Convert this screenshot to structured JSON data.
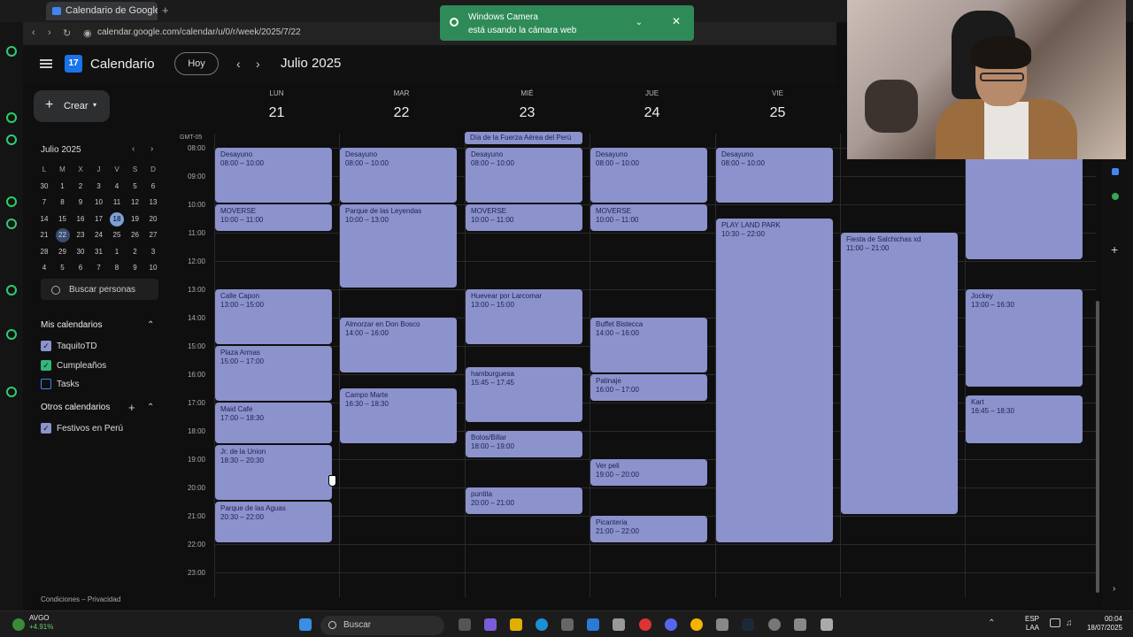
{
  "browser": {
    "tab_title": "Calendario de Google - S",
    "url": "calendar.google.com/calendar/u/0/r/week/2025/7/22"
  },
  "notification": {
    "title": "Windows Camera",
    "body": "está usando la cámara web"
  },
  "header": {
    "app_name": "Calendario",
    "logo_text": "17",
    "today_label": "Hoy",
    "month_label": "Julio 2025"
  },
  "sidebar": {
    "create_label": "Crear",
    "mini_calendar": {
      "title": "Julio 2025",
      "weekday_headers": [
        "L",
        "M",
        "X",
        "J",
        "V",
        "S",
        "D"
      ],
      "weeks": [
        [
          "30",
          "1",
          "2",
          "3",
          "4",
          "5",
          "6"
        ],
        [
          "7",
          "8",
          "9",
          "10",
          "11",
          "12",
          "13"
        ],
        [
          "14",
          "15",
          "16",
          "17",
          "18",
          "19",
          "20"
        ],
        [
          "21",
          "22",
          "23",
          "24",
          "25",
          "26",
          "27"
        ],
        [
          "28",
          "29",
          "30",
          "31",
          "1",
          "2",
          "3"
        ],
        [
          "4",
          "5",
          "6",
          "7",
          "8",
          "9",
          "10"
        ]
      ]
    },
    "search_people": "Buscar personas",
    "my_calendars_title": "Mis calendarios",
    "my_calendars": [
      {
        "label": "TaquitoTD",
        "checked": true,
        "color": "#8c92cc"
      },
      {
        "label": "Cumpleaños",
        "checked": true,
        "color": "#33b679"
      },
      {
        "label": "Tasks",
        "checked": false,
        "color": "#4285f4"
      }
    ],
    "other_calendars_title": "Otros calendarios",
    "other_calendars": [
      {
        "label": "Festivos en Perú",
        "checked": true,
        "color": "#8c92cc"
      }
    ],
    "footer": "Condiciones – Privacidad"
  },
  "week": {
    "timezone": "GMT-05",
    "days": [
      {
        "dow": "LUN",
        "num": "21"
      },
      {
        "dow": "MAR",
        "num": "22"
      },
      {
        "dow": "MIÉ",
        "num": "23"
      },
      {
        "dow": "JUE",
        "num": "24"
      },
      {
        "dow": "VIE",
        "num": "25"
      }
    ],
    "hours": [
      "08:00",
      "09:00",
      "10:00",
      "11:00",
      "12:00",
      "13:00",
      "14:00",
      "15:00",
      "16:00",
      "17:00",
      "18:00",
      "19:00",
      "20:00",
      "21:00",
      "22:00",
      "23:00"
    ],
    "all_day": {
      "title": "Día de la Fuerza Aérea del Perú",
      "day": 2
    },
    "events": [
      {
        "title": "Desayuno",
        "time": "08:00 – 10:00"
      },
      {
        "title": "MOVERSE",
        "time": "10:00 – 11:00"
      },
      {
        "title": "Calle Capon",
        "time": "13:00 – 15:00"
      },
      {
        "title": "Plaza Armas",
        "time": "15:00 – 17:00"
      },
      {
        "title": "Maid Cafe",
        "time": "17:00 – 18:30"
      },
      {
        "title": "Jr. de la Union",
        "time": "18:30 – 20:30"
      },
      {
        "title": "Parque de las Aguas",
        "time": "20:30 – 22:00"
      },
      {
        "title": "Desayuno",
        "time": "08:00 – 10:00"
      },
      {
        "title": "Parque de las Leyendas",
        "time": "10:00 – 13:00"
      },
      {
        "title": "Almorzar en Don Bosco",
        "time": "14:00 – 16:00"
      },
      {
        "title": "Campo Marte",
        "time": "16:30 – 18:30"
      },
      {
        "title": "Desayuno",
        "time": "08:00 – 10:00"
      },
      {
        "title": "MOVERSE",
        "time": "10:00 – 11:00"
      },
      {
        "title": "Huevear por Larcomar",
        "time": "13:00 – 15:00"
      },
      {
        "title": "hamburguesa",
        "time": "15:45 – 17:45"
      },
      {
        "title": "Bolos/Billar",
        "time": "18:00 – 19:00"
      },
      {
        "title": "puntita",
        "time": "20:00 – 21:00"
      },
      {
        "title": "Desayuno",
        "time": "08:00 – 10:00"
      },
      {
        "title": "MOVERSE",
        "time": "10:00 – 11:00"
      },
      {
        "title": "Buffet Bistecca",
        "time": "14:00 – 16:00"
      },
      {
        "title": "Patinaje",
        "time": "16:00 – 17:00"
      },
      {
        "title": "Ver peli",
        "time": "19:00 – 20:00"
      },
      {
        "title": "Picanteria",
        "time": "21:00 – 22:00"
      },
      {
        "title": "Desayuno",
        "time": "08:00 – 10:00"
      },
      {
        "title": "PLAY LAND PARK",
        "time": "10:30 – 22:00"
      },
      {
        "title": "Fiesta de Salchichas xd",
        "time": "11:00 – 21:00"
      },
      {
        "title": "",
        "time": "08:00 – 12:00"
      },
      {
        "title": "Jockey",
        "time": "13:00 – 16:30"
      },
      {
        "title": "Kart",
        "time": "16:45 – 18:30"
      }
    ]
  },
  "taskbar": {
    "weather_title": "AVGO",
    "weather_change": "+4.91%",
    "search_label": "Buscar",
    "lang_line1": "ESP",
    "lang_line2": "LAA",
    "time": "00:04",
    "date": "18/07/2025"
  },
  "colors": {
    "event": "#8c92cc",
    "accent": "#1a73e8",
    "toast": "#2e8b57"
  }
}
